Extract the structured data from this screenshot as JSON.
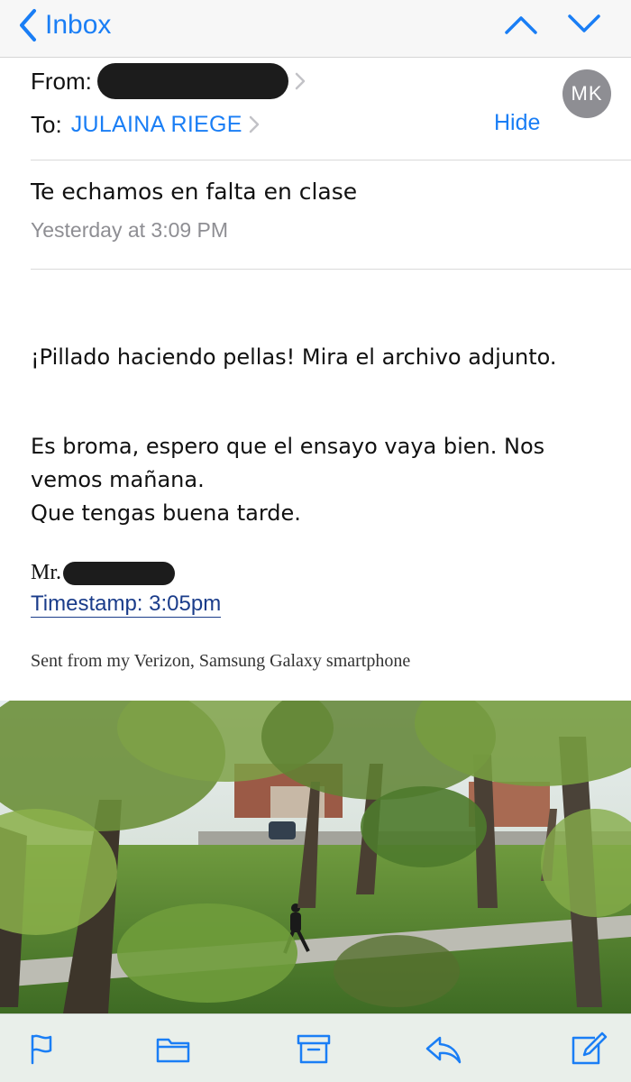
{
  "nav": {
    "back_label": "Inbox"
  },
  "header": {
    "from_label": "From:",
    "to_label": "To:",
    "to_name": "JULAINA RIEGE",
    "hide_label": "Hide",
    "avatar_initials": "MK"
  },
  "message": {
    "subject": "Te echamos en falta en clase",
    "date": "Yesterday at 3:09 PM",
    "paragraph1": "¡Pillado haciendo pellas! Mira el archivo adjunto.",
    "paragraph2_line1": "Es broma, espero que el ensayo vaya bien. Nos",
    "paragraph2_line2": "vemos mañana.",
    "paragraph2_line3": "Que tengas buena tarde.",
    "signature_prefix": "Mr.",
    "timestamp": "Timestamp: 3:05pm",
    "sent_from": "Sent from my Verizon, Samsung Galaxy smartphone"
  },
  "toolbar": {
    "icons": [
      "flag-icon",
      "folder-icon",
      "archive-icon",
      "reply-icon",
      "compose-icon"
    ]
  },
  "colors": {
    "accent": "#1a7ef5",
    "secondary_text": "#8e8e93",
    "timestamp_link": "#1a3c8a",
    "redaction": "#1c1c1c",
    "toolbar_bg": "#e8eee9"
  }
}
